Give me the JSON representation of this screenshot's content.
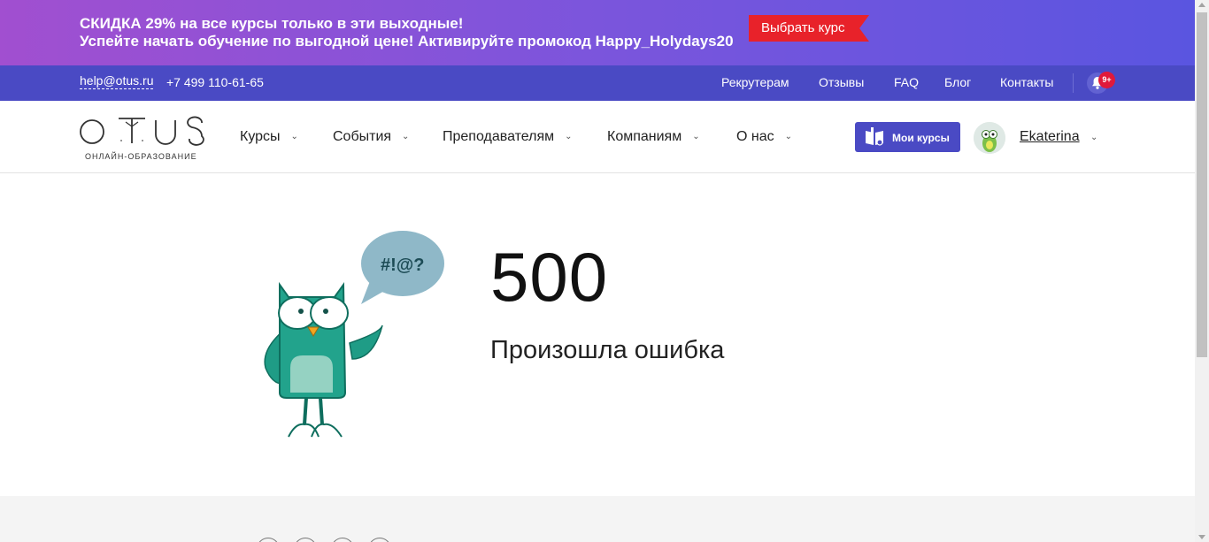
{
  "promo": {
    "line1": "СКИДКА 29% на все курсы только в эти выходные!",
    "line2": "Успейте начать обучение по выгодной цене! Активируйте промокод Happy_Holydays20",
    "button": "Выбрать курс"
  },
  "topbar": {
    "email": "help@otus.ru",
    "phone": "+7 499 110-61-65",
    "links": [
      "Рекрутерам",
      "Отзывы",
      "FAQ",
      "Блог",
      "Контакты"
    ],
    "notifications_badge": "9+"
  },
  "header": {
    "logo_text": "OTUS",
    "logo_subtitle": "ОНЛАЙН-ОБРАЗОВАНИЕ",
    "menu": [
      "Курсы",
      "События",
      "Преподавателям",
      "Компаниям",
      "О нас"
    ],
    "my_courses": "Мои курсы",
    "username": "Ekaterina"
  },
  "error": {
    "code": "500",
    "message": "Произошла ошибка",
    "speech_bubble": "#!@?"
  },
  "colors": {
    "promo_start": "#a14fd0",
    "promo_end": "#5a55e0",
    "topbar": "#4a4ac4",
    "promo_button": "#e8222a",
    "owl_teal": "#21a08a",
    "badge": "#e0193a"
  },
  "icons": {
    "bell": "bell-icon",
    "chevron": "chevron-down-icon",
    "book": "book-icon"
  }
}
